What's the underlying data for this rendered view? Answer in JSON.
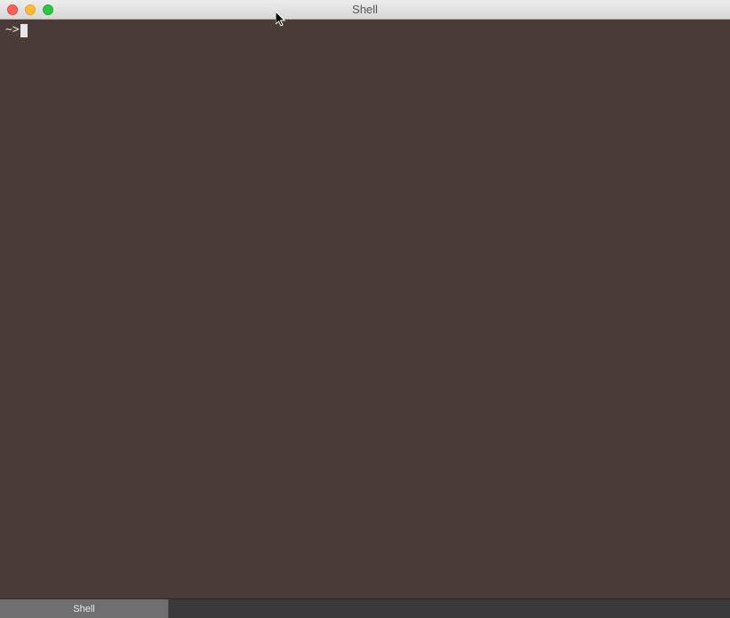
{
  "window": {
    "title": "Shell"
  },
  "terminal": {
    "prompt": "~>"
  },
  "tabs": {
    "items": [
      {
        "label": "Shell"
      }
    ]
  }
}
